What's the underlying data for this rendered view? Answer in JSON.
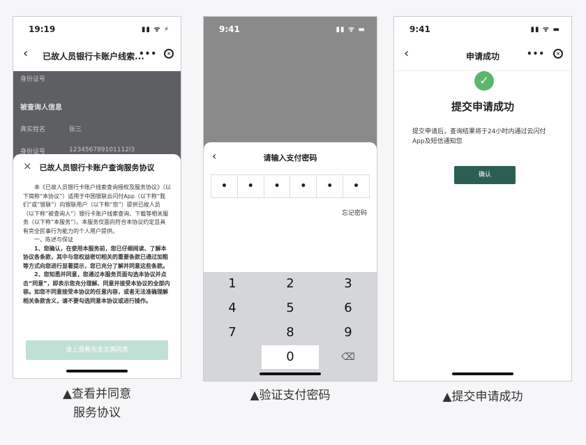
{
  "panels": [
    {
      "status": {
        "time": "19:19",
        "icons": "▮▮ ᯤ ⚡"
      },
      "nav": {
        "back": "‹",
        "title": "已故人员银行卡账户线索...",
        "more": "•••",
        "close": "×"
      },
      "background_rows": [
        {
          "label": "身份证号",
          "value": ""
        },
        {
          "label": "被查询人信息",
          "value": ""
        },
        {
          "label": "真实姓名",
          "value": "张三"
        },
        {
          "label": "身份证号",
          "value": "123456789101112l3"
        }
      ],
      "sheet": {
        "close": "×",
        "title": "已故人员银行卡账户查询服务协议",
        "paragraphs": [
          "本《已故人员银行卡账户线索查询授权及服务协议》（以下简称“本协议”）适用于中国银联云闪付App（以下称“我们”或“银联”）向银联用户（以下称“您”）提供已故人员（以下称“被查询人”）银行卡账户线索查询、下载等相关服务（以下称“本服务”）。本服务仅面向符合本协议约定且具有完全民事行为能力的个人用户提供。",
          "一、陈述与保证",
          "1、您确认，在使用本服务前，您已仔细阅读、了解本协议各条款，其中与您权益密切相关的重要条款已通过加粗等方式向您进行显著提示，您已充分了解并同意这些条款。",
          "2、您知悉并同意，您通过本服务页面勾选本协议并点击“同意”，即表示您充分理解、同意并接受本协议的全部内容。如您不同意接受本协议的任意内容，或者无法准确理解相关条款含义，请不要勾选同意本协议或进行操作。"
        ],
        "button": "请上滑看完全文再同意"
      },
      "caption": [
        "▲查看并同意",
        "服务协议"
      ]
    },
    {
      "status": {
        "time": "9:41",
        "icons": "▮▮ ᯤ ▬"
      },
      "sheet": {
        "back": "‹",
        "title": "请输入支付密码",
        "pin": [
          "•",
          "•",
          "•",
          "•",
          "•",
          "•"
        ],
        "forgot": "忘记密码"
      },
      "keypad": [
        "1",
        "2",
        "3",
        "4",
        "5",
        "6",
        "7",
        "8",
        "9",
        "0",
        "⌫"
      ],
      "caption": [
        "▲验证支付密码"
      ]
    },
    {
      "status": {
        "time": "9:41",
        "icons": "▮▮ ᯤ ▬"
      },
      "nav": {
        "back": "‹",
        "title": "申请成功",
        "more": "•••",
        "close": "×"
      },
      "success": {
        "check": "✓",
        "title": "提交申请成功",
        "message": "提交申请后，查询结果将于24小时内通过云闪付App及短信通知您",
        "button": "确认"
      },
      "caption": [
        "▲提交申请成功"
      ]
    }
  ],
  "colors": {
    "success_green": "#59b86c",
    "confirm_button": "#2d5e54",
    "disabled_button": "#bfe0d2"
  }
}
